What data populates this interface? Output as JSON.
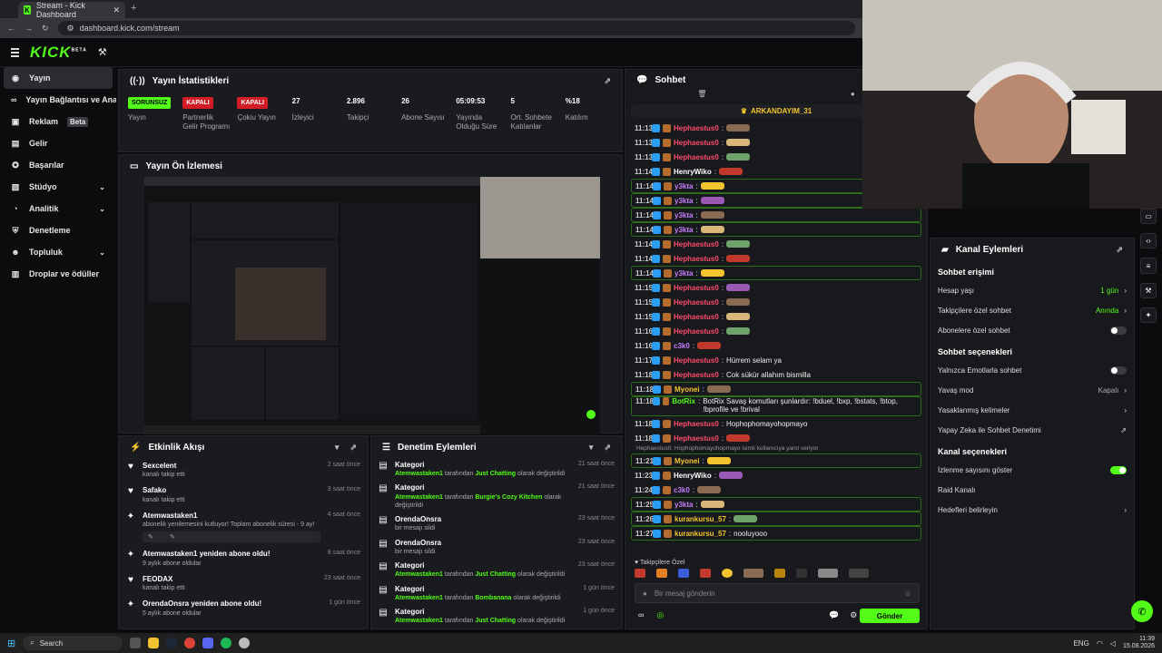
{
  "browser": {
    "tab_title": "Stream - Kick Dashboard",
    "url": "dashboard.kick.com/stream"
  },
  "app": {
    "brand": "KICK",
    "brand_sup": "BETA"
  },
  "sidebar": {
    "items": [
      {
        "label": "Yayın",
        "icon": "broadcast-icon",
        "active": true
      },
      {
        "label": "Yayın Bağlantısı ve Anahtarı",
        "icon": "link-icon"
      },
      {
        "label": "Reklam",
        "icon": "ad-icon",
        "badge": "Beta"
      },
      {
        "label": "Gelir",
        "icon": "wallet-icon"
      },
      {
        "label": "Başarılar",
        "icon": "trophy-icon"
      },
      {
        "label": "Stüdyo",
        "icon": "studio-icon",
        "chevron": true
      },
      {
        "label": "Analitik",
        "icon": "chart-icon",
        "chevron": true
      },
      {
        "label": "Denetleme",
        "icon": "shield-icon"
      },
      {
        "label": "Topluluk",
        "icon": "users-icon",
        "chevron": true
      },
      {
        "label": "Droplar ve ödüller",
        "icon": "gift-icon"
      }
    ]
  },
  "stats": {
    "title": "Yayın İstatistikleri",
    "items": [
      {
        "value": "SORUNSUZ",
        "label": "Yayın",
        "kind": "badge-green"
      },
      {
        "value": "KAPALI",
        "label": "Partnerlik Gelir Programı",
        "kind": "badge-red"
      },
      {
        "value": "KAPALI",
        "label": "Çokiu Yayın",
        "kind": "badge-red"
      },
      {
        "value": "27",
        "label": "İzleyici"
      },
      {
        "value": "2.896",
        "label": "Takipçi"
      },
      {
        "value": "26",
        "label": "Abone Sayısı"
      },
      {
        "value": "05:09:53",
        "label": "Yayında Olduğu Süre"
      },
      {
        "value": "5",
        "label": "Ort. Sohbete Katılanlar"
      },
      {
        "value": "%18",
        "label": "Katılım"
      }
    ]
  },
  "preview": {
    "title": "Yayın Ön İzlemesi"
  },
  "activity": {
    "title": "Etkinlik Akışı",
    "items": [
      {
        "icon": "heart-icon",
        "name": "Sexcelent",
        "sub": "kanalı takip etti",
        "time": "2 saat önce"
      },
      {
        "icon": "heart-icon",
        "name": "Safako",
        "sub": "kanalı takip etti",
        "time": "3 saat önce"
      },
      {
        "icon": "star-icon",
        "name": "Atemwastaken1",
        "sub": "abonelik yenilemesini kutluyor! Toplam abonelik süresi - 9 ay!",
        "time": "4 saat önce"
      },
      {
        "icon": "star-icon",
        "name": "Atemwastaken1 yeniden abone oldu!",
        "sub": "9 aylık abone oldular",
        "time": "8 saat önce"
      },
      {
        "icon": "heart-icon",
        "name": "FEODAX",
        "sub": "kanalı takip etti",
        "time": "23 saat önce"
      },
      {
        "icon": "star-icon",
        "name": "OrendaOnsra yeniden abone oldu!",
        "sub": "5 aylık abone oldular",
        "time": "1 gün önce"
      }
    ]
  },
  "mod": {
    "title": "Denetim Eylemleri",
    "items": [
      {
        "name": "Kategori",
        "user": "Atemwastaken1",
        "mid": "tarafından",
        "green": "Just Chatting",
        "rest": "olarak değiştirildi",
        "time": "21 saat önce"
      },
      {
        "name": "Kategori",
        "user": "Atemwastaken1",
        "mid": "tarafından",
        "green": "Burgie's Cozy Kitchen",
        "rest": "olarak değiştirildi",
        "time": "21 saat önce"
      },
      {
        "name": "OrendaOnsra",
        "user": "",
        "mid": "bir mesajı sildi",
        "green": "",
        "rest": "",
        "time": "23 saat önce"
      },
      {
        "name": "OrendaOnsra",
        "user": "",
        "mid": "bir mesajı sildi",
        "green": "",
        "rest": "",
        "time": "23 saat önce"
      },
      {
        "name": "Kategori",
        "user": "Atemwastaken1",
        "mid": "tarafından",
        "green": "Just Chatting",
        "rest": "olarak değiştirildi",
        "time": "23 saat önce"
      },
      {
        "name": "Kategori",
        "user": "Atemwastaken1",
        "mid": "tarafından",
        "green": "Bombanana",
        "rest": "olarak değiştirildi",
        "time": "1 gün önce"
      },
      {
        "name": "Kategori",
        "user": "Atemwastaken1",
        "mid": "tarafından",
        "green": "Just Chatting",
        "rest": "olarak değiştirildi",
        "time": "1 gün önce"
      }
    ]
  },
  "chat": {
    "title": "Sohbet",
    "pinned": "ARKANDAYIM_31",
    "messages": [
      {
        "t": "11:13",
        "u": "Hephaestus0",
        "c": "#ff4d6d",
        "m": "",
        "e": true
      },
      {
        "t": "11:13",
        "u": "Hephaestus0",
        "c": "#ff4d6d",
        "m": "",
        "e": true
      },
      {
        "t": "11:13",
        "u": "Hephaestus0",
        "c": "#ff4d6d",
        "m": "",
        "e": true
      },
      {
        "t": "11:14",
        "u": "HenryWiko",
        "c": "#ffffff",
        "m": "",
        "e": true
      },
      {
        "t": "11:14",
        "u": "y3kta",
        "c": "#c77dff",
        "m": "",
        "e": true,
        "hl": true
      },
      {
        "t": "11:14",
        "u": "y3kta",
        "c": "#c77dff",
        "m": "",
        "e": true,
        "hl": true
      },
      {
        "t": "11:14",
        "u": "y3kta",
        "c": "#c77dff",
        "m": "",
        "e": true,
        "hl": true
      },
      {
        "t": "11:14",
        "u": "y3kta",
        "c": "#c77dff",
        "m": "",
        "e": true,
        "hl": true
      },
      {
        "t": "11:14",
        "u": "Hephaestus0",
        "c": "#ff4d6d",
        "m": "",
        "e": true
      },
      {
        "t": "11:14",
        "u": "Hephaestus0",
        "c": "#ff4d6d",
        "m": "",
        "e": true
      },
      {
        "t": "11:14",
        "u": "y3kta",
        "c": "#c77dff",
        "m": "",
        "e": true,
        "hl": true
      },
      {
        "t": "11:15",
        "u": "Hephaestus0",
        "c": "#ff4d6d",
        "m": "",
        "e": true
      },
      {
        "t": "11:15",
        "u": "Hephaestus0",
        "c": "#ff4d6d",
        "m": "",
        "e": true
      },
      {
        "t": "11:15",
        "u": "Hephaestus0",
        "c": "#ff4d6d",
        "m": "",
        "e": true
      },
      {
        "t": "11:16",
        "u": "Hephaestus0",
        "c": "#ff4d6d",
        "m": "",
        "e": true
      },
      {
        "t": "11:16",
        "u": "c3k0",
        "c": "#c77dff",
        "m": "",
        "e": true
      },
      {
        "t": "11:17",
        "u": "Hephaestus0",
        "c": "#ff4d6d",
        "m": "Hürrem selam ya",
        "e": false
      },
      {
        "t": "11:18",
        "u": "Hephaestus0",
        "c": "#ff4d6d",
        "m": "Cok sükür allahım bismilla",
        "e": false
      },
      {
        "t": "11:18",
        "u": "Myonei",
        "c": "#f4c430",
        "m": "",
        "e": true,
        "hl": true
      },
      {
        "t": "11:18",
        "u": "BotRix",
        "c": "#53fc18",
        "m": "BotRix Savaş komutları şunlardır: !bduel, !bxp, !bstats, !btop, !bprofile ve !brival",
        "e": false,
        "hl": true,
        "tall": true
      },
      {
        "t": "11:18",
        "u": "Hephaestus0",
        "c": "#ff4d6d",
        "m": "Hophophomayohopmayo",
        "e": false
      },
      {
        "t": "11:18",
        "u": "Hephaestus0",
        "c": "#ff4d6d",
        "m": "",
        "e": true
      },
      {
        "t": "11:21",
        "u": "Myonei",
        "c": "#f4c430",
        "m": "",
        "e": true,
        "hl": true,
        "reply": "Hephaestus0: Hophophomayohopmayo isimli kullanıcıya yanıt veriyor"
      },
      {
        "t": "11:23",
        "u": "HenryWiko",
        "c": "#ffffff",
        "m": "",
        "e": true
      },
      {
        "t": "11:24",
        "u": "c3k0",
        "c": "#c77dff",
        "m": "",
        "e": true
      },
      {
        "t": "11:25",
        "u": "y3kta",
        "c": "#c77dff",
        "m": "",
        "e": true,
        "hl": true
      },
      {
        "t": "11:26",
        "u": "kurankursu_57",
        "c": "#f4c430",
        "m": "",
        "e": true,
        "hl": true
      },
      {
        "t": "11:27",
        "u": "kurankursu_57",
        "c": "#f4c430",
        "m": "nooluyooo",
        "e": false,
        "hl": true
      }
    ],
    "follower_label": "Takipçilere Özel",
    "input_placeholder": "Bir mesaj gönderin",
    "send": "Gönder"
  },
  "kanal": {
    "title": "Kanal Eylemleri",
    "sections": [
      {
        "title": "Sohbet erişimi",
        "rows": [
          {
            "label": "Hesap yaşı",
            "value": "1 gün",
            "kind": "green-chev"
          },
          {
            "label": "Takipçilere özel sohbet",
            "value": "Anında",
            "kind": "green-chev"
          },
          {
            "label": "Abonelere özel sohbet",
            "kind": "toggle-off"
          }
        ]
      },
      {
        "title": "Sohbet seçenekleri",
        "rows": [
          {
            "label": "Yalnızca Emotlarla sohbet",
            "kind": "toggle-off"
          },
          {
            "label": "Yavaş mod",
            "value": "Kapalı",
            "kind": "grey-chev"
          },
          {
            "label": "Yasaklanmış kelimeler",
            "kind": "chev"
          },
          {
            "label": "Yapay Zeka ile Sohbet Denetimi",
            "kind": "ext"
          }
        ]
      },
      {
        "title": "Kanal seçenekleri",
        "rows": [
          {
            "label": "İzlenme sayısını göster",
            "kind": "toggle-on"
          },
          {
            "label": "Raid Kanalı",
            "kind": "none"
          },
          {
            "label": "Hedefleri belirleyin",
            "kind": "chev"
          }
        ]
      }
    ]
  },
  "taskbar": {
    "search": "Search",
    "lang": "ENG",
    "time": "11:39",
    "date": "15.08.2026"
  },
  "colors": {
    "accent": "#53fc18",
    "danger": "#d21d26",
    "panel": "#191b1f"
  }
}
